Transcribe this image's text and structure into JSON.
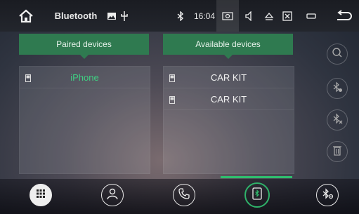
{
  "statusbar": {
    "title": "Bluetooth",
    "time": "16:04",
    "icons": [
      "home-icon",
      "gallery-icon",
      "usb-icon",
      "bluetooth-icon",
      "screenshot-icon",
      "volume-icon",
      "eject-icon",
      "close-box-icon",
      "minimize-icon",
      "back-icon"
    ]
  },
  "paired": {
    "title": "Paired devices",
    "devices": [
      {
        "name": "iPhone",
        "icon": "phone-icon"
      }
    ]
  },
  "available": {
    "title": "Available devices",
    "devices": [
      {
        "name": "CAR KIT",
        "icon": "phone-icon"
      },
      {
        "name": "CAR KIT",
        "icon": "phone-icon"
      }
    ]
  },
  "side_actions": [
    "search-icon",
    "bluetooth-disconnect-icon",
    "bluetooth-remove-icon",
    "trash-icon"
  ],
  "bottom_nav": [
    "apps-grid-icon",
    "contacts-icon",
    "phone-call-icon",
    "bluetooth-devices-icon",
    "bluetooth-settings-icon"
  ],
  "colors": {
    "accent": "#2fbf6e",
    "tab_bg": "#2f7a50",
    "paired_text": "#3fcf82"
  }
}
